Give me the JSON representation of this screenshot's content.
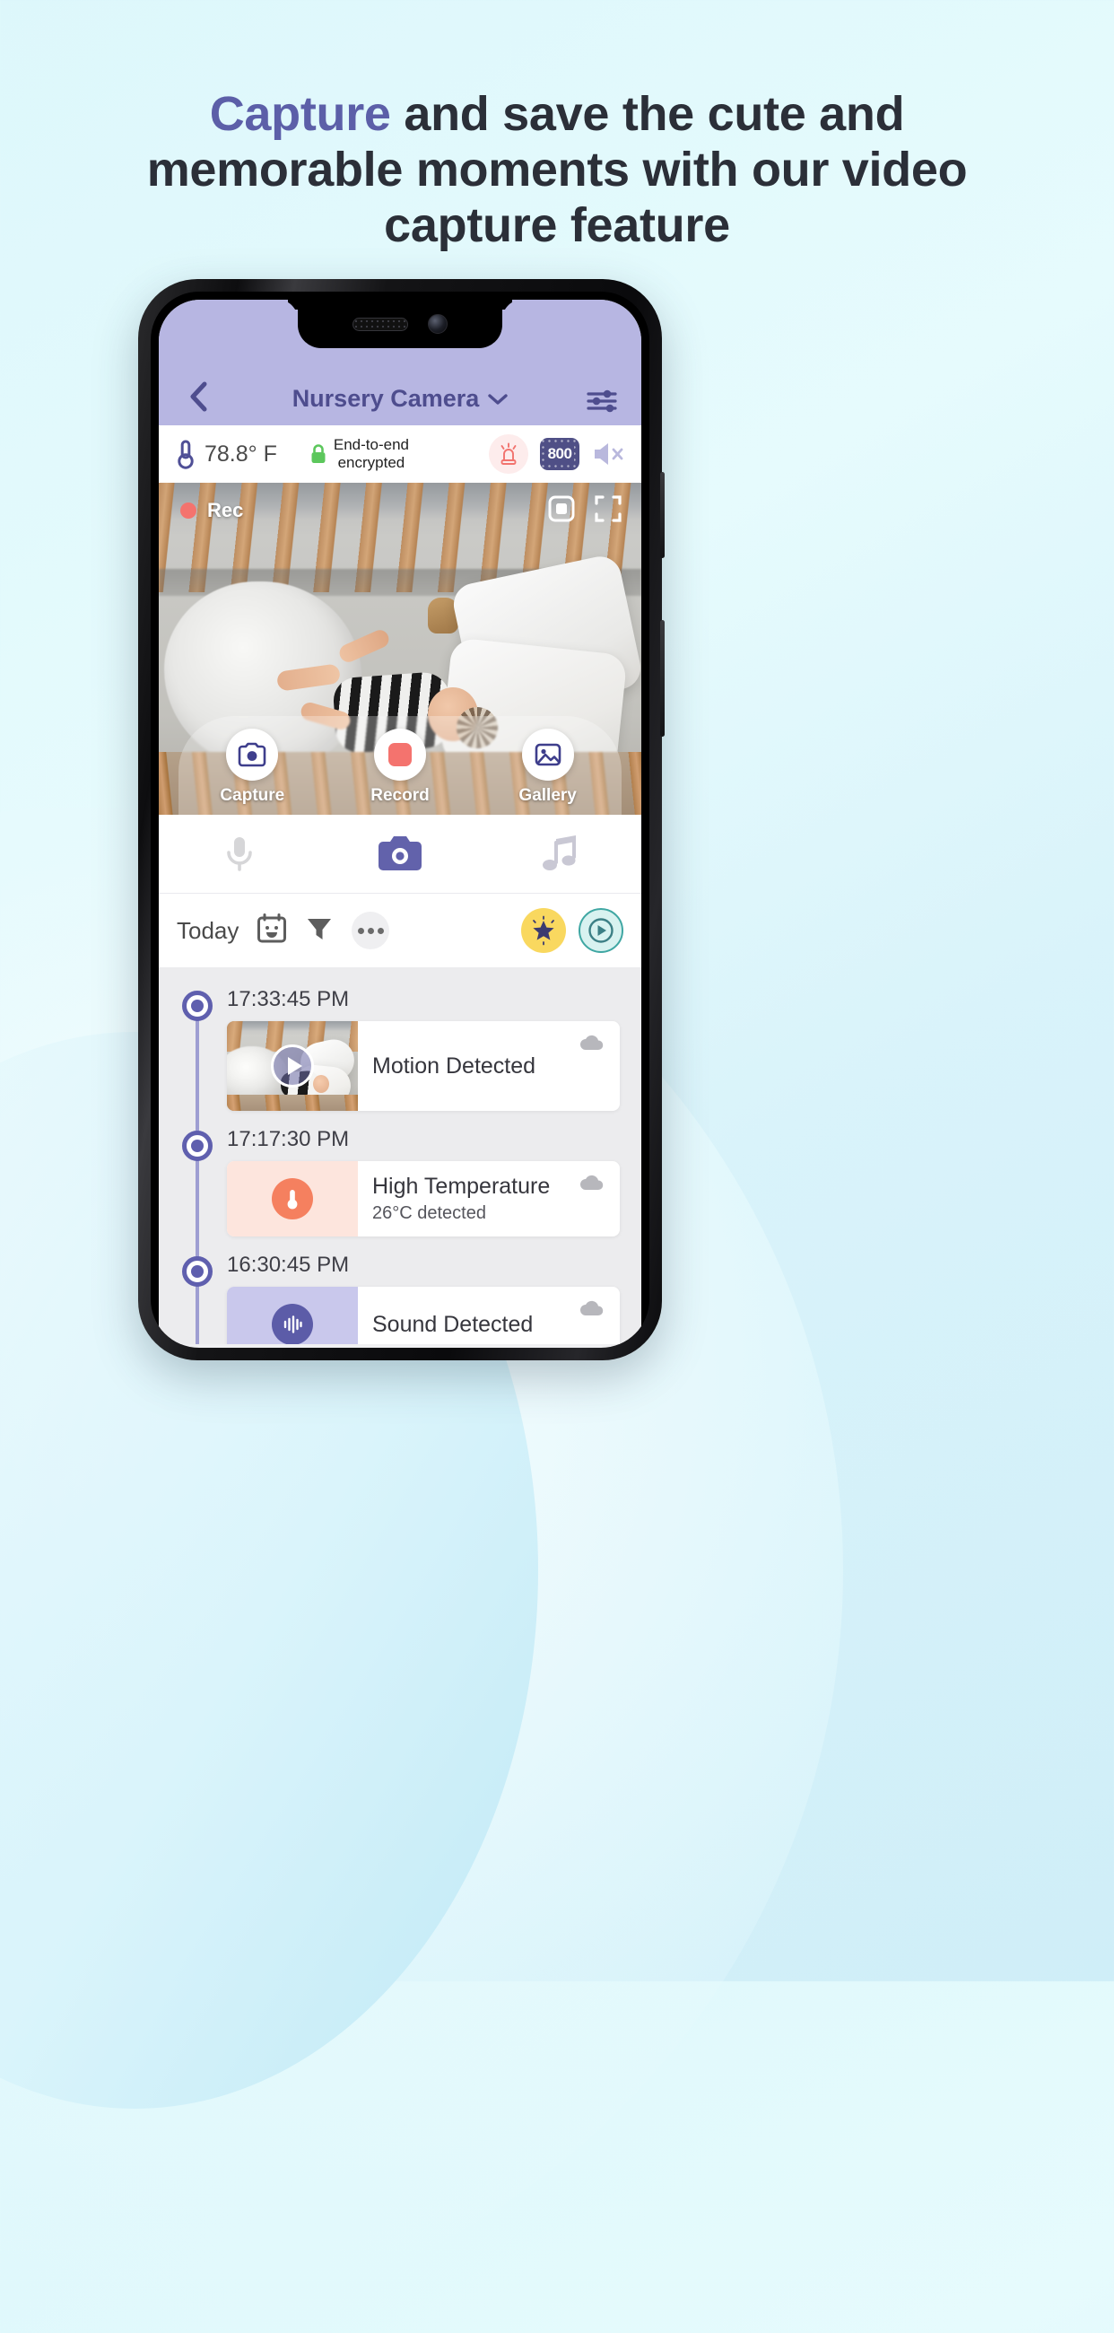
{
  "headline": {
    "accent_word": "Capture",
    "rest": " and save the cute and memorable moments with our video capture feature",
    "accent_color": "#5c5fa8"
  },
  "app": {
    "header": {
      "back_icon": "chevron-left-icon",
      "title": "Nursery Camera",
      "title_caret_icon": "chevron-down-icon",
      "settings_icon": "sliders-icon",
      "bg_color": "#b7b6e2",
      "title_color": "#4e4d8e"
    },
    "status_strip": {
      "temperature_icon": "thermometer-icon",
      "temperature": "78.8° F",
      "lock_icon": "lock-icon",
      "encryption_line1": "End-to-end",
      "encryption_line2": "encrypted",
      "siren_icon": "siren-icon",
      "resolution_badge": "800",
      "mute_icon": "speaker-mute-icon"
    },
    "video": {
      "rec_label": "Rec",
      "rec_dot_color": "#f4736e",
      "picture_in_picture_icon": "pip-icon",
      "fullscreen_icon": "fullscreen-icon",
      "controls": [
        {
          "icon": "camera-icon",
          "label": "Capture"
        },
        {
          "icon": "record-square-icon",
          "label": "Record"
        },
        {
          "icon": "gallery-icon",
          "label": "Gallery"
        }
      ]
    },
    "mode_tabs": [
      {
        "icon": "microphone-icon",
        "active": false
      },
      {
        "icon": "camera-icon",
        "active": true
      },
      {
        "icon": "music-note-icon",
        "active": false
      }
    ],
    "filter_row": {
      "today_label": "Today",
      "calendar_icon": "calendar-smiley-icon",
      "filter_icon": "funnel-icon",
      "more_icon": "more-dots-icon",
      "star_icon": "star-icon",
      "timer_icon": "history-play-icon"
    },
    "timeline": [
      {
        "time": "17:33:45 PM",
        "thumb_type": "video",
        "thumb_icon": "play-icon",
        "title": "Motion Detected",
        "subtitle": "",
        "cloud_icon": "cloud-icon"
      },
      {
        "time": "17:17:30 PM",
        "thumb_type": "temperature",
        "thumb_icon": "thermometer-icon",
        "title": "High Temperature",
        "subtitle": "26°C  detected",
        "cloud_icon": "cloud-icon"
      },
      {
        "time": "16:30:45 PM",
        "thumb_type": "sound",
        "thumb_icon": "sound-wave-icon",
        "title": "Sound Detected",
        "subtitle": "",
        "cloud_icon": "cloud-icon"
      }
    ]
  }
}
